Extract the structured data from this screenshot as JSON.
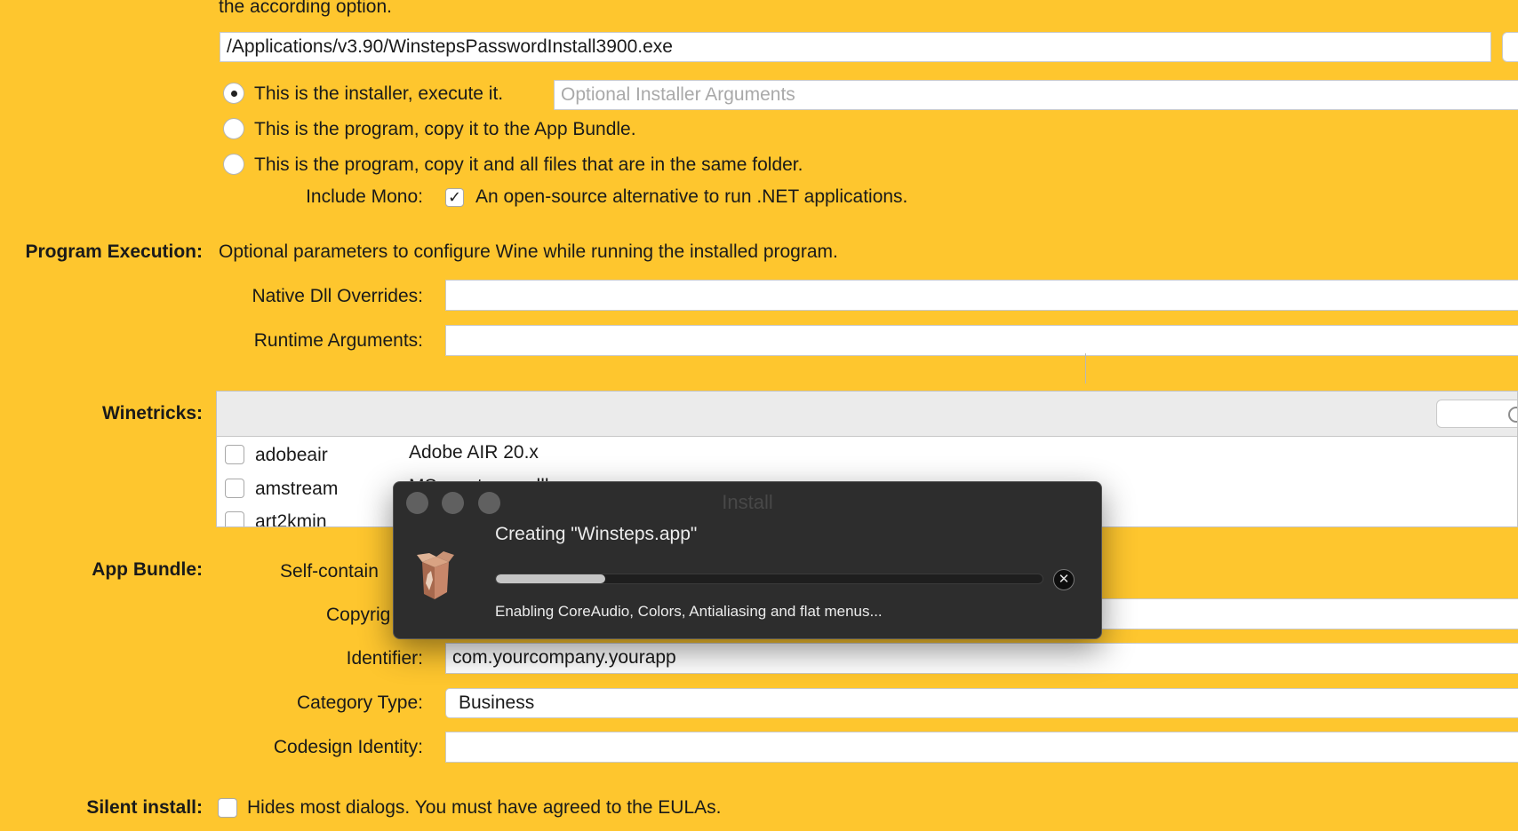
{
  "window": {
    "background": "#FEC62E"
  },
  "installer": {
    "top_text": "the according option.",
    "path": "/Applications/v3.90/WinstepsPasswordInstall3900.exe",
    "options": [
      "This is the installer, execute it.",
      "This is the program, copy it to the App Bundle.",
      "This is the program, copy it and all files that are in the same folder."
    ],
    "selected_option": 0,
    "arguments_placeholder": "Optional Installer Arguments",
    "include_mono_label": "Include Mono:",
    "include_mono_text": "An open-source alternative to run .NET applications.",
    "include_mono_checked": true,
    "check_glyph": "✓"
  },
  "program_execution": {
    "section_label": "Program Execution:",
    "description": "Optional parameters to configure Wine while running the installed program.",
    "dll_overrides_label": "Native Dll Overrides:",
    "dll_overrides_value": "",
    "runtime_args_label": "Runtime Arguments:",
    "runtime_args_value": ""
  },
  "winetricks": {
    "section_label": "Winetricks:",
    "rows": [
      {
        "name": "adobeair",
        "description": "Adobe AIR 20.x"
      },
      {
        "name": "amstream",
        "description": "MS amstream.dll"
      },
      {
        "name": "art2kmin",
        "description": ""
      }
    ]
  },
  "app_bundle": {
    "section_label": "App Bundle:",
    "self_contained_label": "Self-contain",
    "copyright_label": "Copyrig",
    "identifier_label": "Identifier:",
    "identifier_value": "com.yourcompany.yourapp",
    "category_label": "Category Type:",
    "category_value": "Business",
    "codesign_label": "Codesign Identity:",
    "codesign_value": ""
  },
  "silent_install": {
    "section_label": "Silent install:",
    "text": "Hides most dialogs. You must have agreed to the EULAs.",
    "checked": false
  },
  "dialog": {
    "title": "Install",
    "heading": "Creating \"Winsteps.app\"",
    "status": "Enabling CoreAudio, Colors, Antialiasing  and flat menus...",
    "progress": 0.2,
    "cancel_glyph": "✕",
    "icon": "package-box-icon"
  }
}
